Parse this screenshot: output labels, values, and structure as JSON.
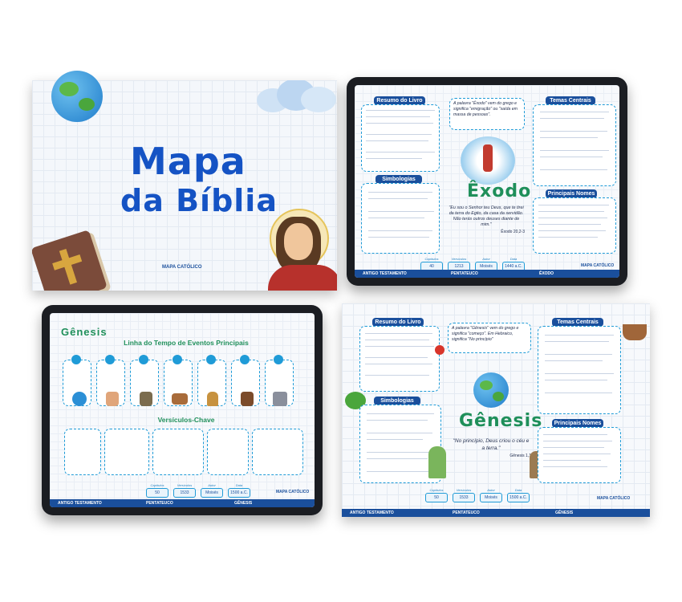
{
  "cover": {
    "title_line1": "Mapa",
    "title_line2": "da Bíblia",
    "brand": "MAPA CATÓLICO"
  },
  "exodo": {
    "title": "Êxodo",
    "resumo_label": "Resumo do Livro",
    "temas_label": "Temas Centrais",
    "simbologias_label": "Simbologias",
    "nomes_label": "Principais Nomes",
    "intro": "A palavra \"Êxodo\" vem do grego e significa \"emigração\" ou \"saída em massa de pessoas\".",
    "verse": "\"Eu sou o Senhor teu Deus, que te tirei da terra do Egito, da casa da servidão. Não terás outros deuses diante de mim.\"",
    "verse_ref": "Êxodo 20,2-3",
    "facts": [
      {
        "label": "Capítulos",
        "value": "40"
      },
      {
        "label": "Versículos",
        "value": "1213"
      },
      {
        "label": "Autor",
        "value": "Moisés"
      },
      {
        "label": "Data",
        "value": "1440 a.C."
      }
    ],
    "footer": [
      "ANTIGO TESTAMENTO",
      "PENTATEUCO",
      "ÊXODO"
    ],
    "brand": "MAPA CATÓLICO"
  },
  "genesis_timeline": {
    "title": "Gênesis",
    "timeline_label": "Linha do Tempo de Eventos Principais",
    "chave_label": "Versículos-Chave",
    "facts": [
      {
        "label": "Capítulos",
        "value": "50"
      },
      {
        "label": "Versículos",
        "value": "1533"
      },
      {
        "label": "Autor",
        "value": "Moisés"
      },
      {
        "label": "Data",
        "value": "1500 a.C."
      }
    ],
    "footer": [
      "ANTIGO TESTAMENTO",
      "PENTATEUCO",
      "GÊNESIS"
    ],
    "brand": "MAPA CATÓLICO"
  },
  "genesis_map": {
    "title": "Gênesis",
    "resumo_label": "Resumo do Livro",
    "temas_label": "Temas Centrais",
    "simbologias_label": "Simbologias",
    "nomes_label": "Principais Nomes",
    "intro": "A palavra \"Gênesis\" vem do grego e significa \"começo\". Em Hebraico, significa \"No princípio\"",
    "verse": "\"No princípio, Deus criou o céu e a terra.\"",
    "verse_ref": "Gênesis 1,1",
    "facts": [
      {
        "label": "Capítulos",
        "value": "50"
      },
      {
        "label": "Versículos",
        "value": "1533"
      },
      {
        "label": "Autor",
        "value": "Moisés"
      },
      {
        "label": "Data",
        "value": "1500 a.C."
      }
    ],
    "footer": [
      "ANTIGO TESTAMENTO",
      "PENTATEUCO",
      "GÊNESIS"
    ],
    "brand": "MAPA CATÓLICO"
  }
}
